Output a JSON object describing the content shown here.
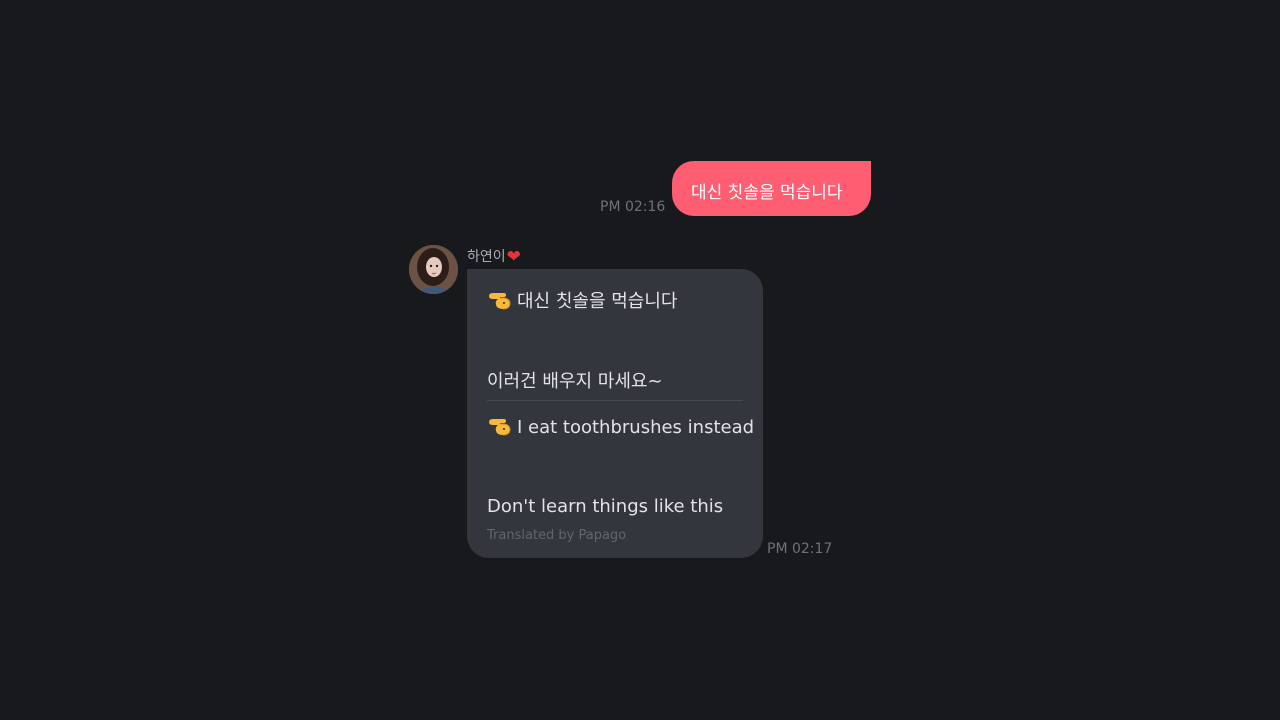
{
  "outgoing": {
    "text": "대신 칫솔을 먹습니다",
    "time": "PM 02:16",
    "bubble_color": "#fe5d72"
  },
  "incoming": {
    "sender_name": "하연이",
    "sender_badge_icon": "heart-icon",
    "avatar_icon": "profile-photo",
    "original_line_1": "대신 칫솔을 먹습니다",
    "original_line_2": "이러건 배우지 마세요~",
    "translated_line_1": "I eat toothbrushes instead",
    "translated_line_2": "Don't learn things like this",
    "translation_credit": "Translated by Papago",
    "time": "PM 02:17",
    "bubble_color": "#33363d",
    "line_icon": "pointing-hand-icon"
  },
  "background_color": "#18191d"
}
